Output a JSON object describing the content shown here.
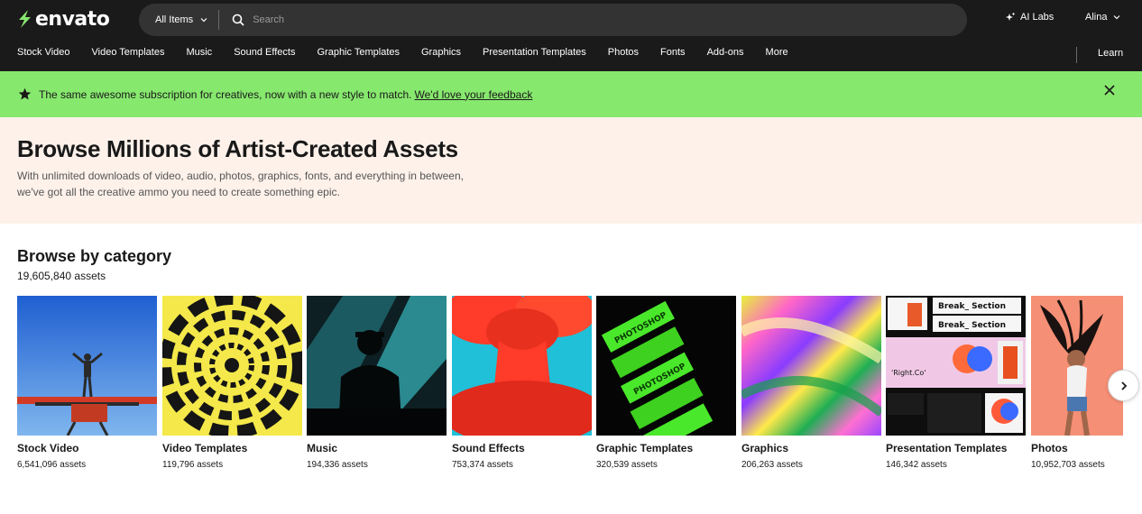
{
  "header": {
    "logo_text": "envato",
    "search_scope": "All Items",
    "search_placeholder": "Search",
    "ai_labs": "AI Labs",
    "user_name": "Alina",
    "learn": "Learn"
  },
  "nav": {
    "items": [
      "Stock Video",
      "Video Templates",
      "Music",
      "Sound Effects",
      "Graphic Templates",
      "Graphics",
      "Presentation Templates",
      "Photos",
      "Fonts",
      "Add-ons",
      "More"
    ]
  },
  "announcement": {
    "text": "The same awesome subscription for creatives, now with a new style to match.",
    "link": "We'd love your feedback"
  },
  "hero": {
    "title": "Browse Millions of Artist-Created Assets",
    "subtitle_line1": "With unlimited downloads of video, audio, photos, graphics, fonts, and everything in between,",
    "subtitle_line2": "we've got all the creative ammo you need to create something epic."
  },
  "categories": {
    "title": "Browse by category",
    "total": "19,605,840 assets",
    "items": [
      {
        "name": "Stock Video",
        "count": "6,541,096 assets"
      },
      {
        "name": "Video Templates",
        "count": "119,796 assets"
      },
      {
        "name": "Music",
        "count": "194,336 assets"
      },
      {
        "name": "Sound Effects",
        "count": "753,374 assets"
      },
      {
        "name": "Graphic Templates",
        "count": "320,539 assets"
      },
      {
        "name": "Graphics",
        "count": "206,263 assets"
      },
      {
        "name": "Presentation Templates",
        "count": "146,342 assets"
      },
      {
        "name": "Photos",
        "count": "10,952,703 assets"
      }
    ],
    "thumb_text": {
      "photoshop": "PHOTOSHOP",
      "break_section": "Break_ Section",
      "right_co": "'Right.Co'"
    }
  },
  "colors": {
    "header_bg": "#1a1a1a",
    "brand_green": "#87e86e",
    "hero_bg": "#fdf1ea"
  }
}
